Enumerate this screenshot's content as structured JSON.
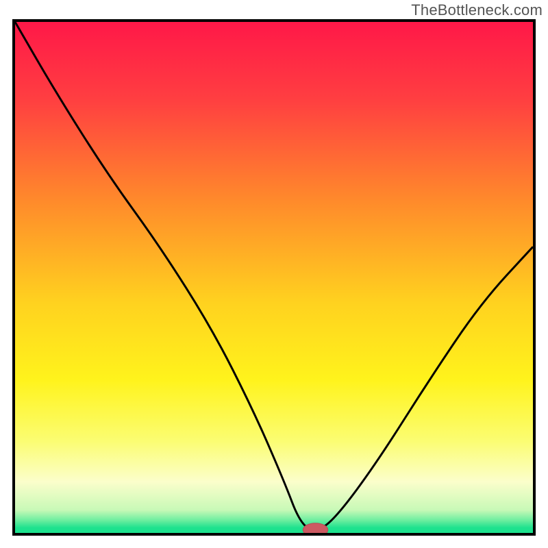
{
  "branding": {
    "watermark": "TheBottleneck.com"
  },
  "colors": {
    "frame": "#000000",
    "curve": "#000000",
    "marker_fill": "#cc5a62",
    "marker_stroke": "#b84f57",
    "gradient_stops": [
      {
        "offset": 0.0,
        "color": "#ff1848"
      },
      {
        "offset": 0.15,
        "color": "#ff3e41"
      },
      {
        "offset": 0.35,
        "color": "#ff8a2b"
      },
      {
        "offset": 0.55,
        "color": "#ffd21f"
      },
      {
        "offset": 0.7,
        "color": "#fff31c"
      },
      {
        "offset": 0.82,
        "color": "#fbfd72"
      },
      {
        "offset": 0.9,
        "color": "#fbfecb"
      },
      {
        "offset": 0.955,
        "color": "#c8f9b7"
      },
      {
        "offset": 0.975,
        "color": "#6eeea0"
      },
      {
        "offset": 0.99,
        "color": "#1de28e"
      },
      {
        "offset": 1.0,
        "color": "#1de28e"
      }
    ]
  },
  "chart_data": {
    "type": "line",
    "title": "",
    "xlabel": "",
    "ylabel": "",
    "x_range": [
      0,
      100
    ],
    "y_range": [
      0,
      100
    ],
    "note": "Curve read off plot in normalized 0-100 coords; minimum ≈ x 58, y 0",
    "series": [
      {
        "name": "bottleneck-curve",
        "x": [
          0,
          8,
          18,
          28,
          38,
          46,
          52,
          55,
          58,
          62,
          70,
          80,
          90,
          100
        ],
        "y": [
          100,
          86,
          70,
          56,
          40,
          24,
          10,
          2,
          0,
          3,
          14,
          30,
          45,
          56
        ]
      }
    ],
    "marker": {
      "x": 58,
      "y": 0.6,
      "rx": 2.4,
      "ry": 1.3
    }
  }
}
